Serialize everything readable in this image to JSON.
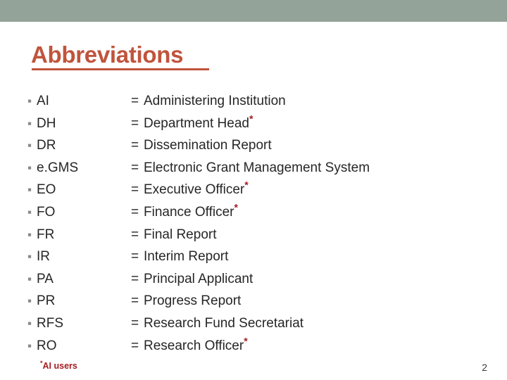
{
  "slide": {
    "title": "Abbreviations",
    "accent_color": "#c0543c",
    "band_color": "#94a399",
    "bullet_glyph": "▪",
    "equals_sign": "=",
    "asterisk": "*"
  },
  "abbreviations": [
    {
      "term": "AI",
      "definition": "Administering Institution",
      "starred": false
    },
    {
      "term": "DH",
      "definition": "Department Head",
      "starred": true
    },
    {
      "term": "DR",
      "definition": "Dissemination Report",
      "starred": false
    },
    {
      "term": "e.GMS",
      "definition": "Electronic Grant Management System",
      "starred": false
    },
    {
      "term": "EO",
      "definition": "Executive Officer",
      "starred": true
    },
    {
      "term": "FO",
      "definition": "Finance Officer",
      "starred": true
    },
    {
      "term": "FR",
      "definition": "Final Report",
      "starred": false
    },
    {
      "term": "IR",
      "definition": "Interim Report",
      "starred": false
    },
    {
      "term": "PA",
      "definition": "Principal Applicant",
      "starred": false
    },
    {
      "term": "PR",
      "definition": "Progress Report",
      "starred": false
    },
    {
      "term": "RFS",
      "definition": "Research Fund Secretariat",
      "starred": false
    },
    {
      "term": "RO",
      "definition": "Research Officer",
      "starred": true
    }
  ],
  "footnote": {
    "marker": "*",
    "text": "AI users"
  },
  "page_number": "2"
}
